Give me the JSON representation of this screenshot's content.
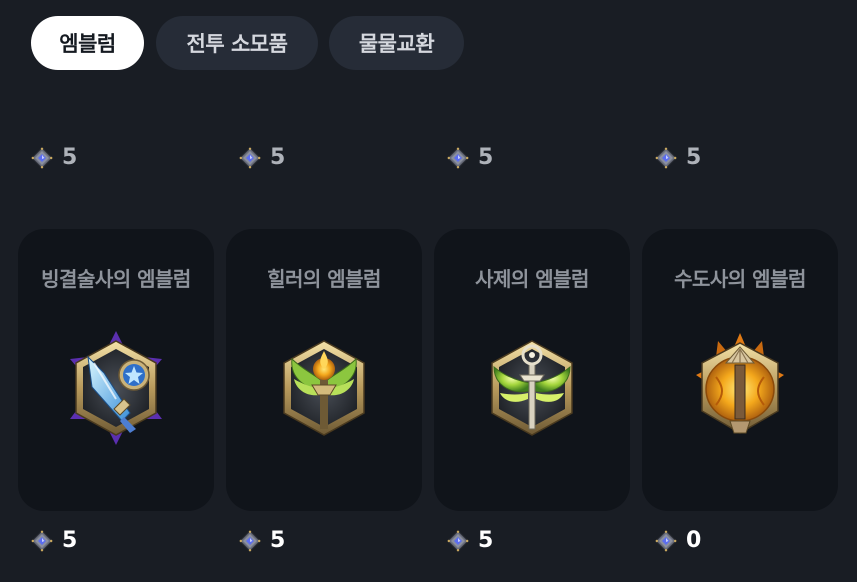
{
  "tabs": [
    {
      "label": "엠블럼",
      "active": true
    },
    {
      "label": "전투 소모품",
      "active": false
    },
    {
      "label": "물물교환",
      "active": false
    }
  ],
  "top_prices": [
    {
      "value": "5"
    },
    {
      "value": "5"
    },
    {
      "value": "5"
    },
    {
      "value": "5"
    }
  ],
  "items": [
    {
      "name": "빙결술사의 엠블럼",
      "price": "5",
      "icon": "frost-mage-emblem-icon"
    },
    {
      "name": "힐러의 엠블럼",
      "price": "5",
      "icon": "healer-emblem-icon"
    },
    {
      "name": "사제의 엠블럼",
      "price": "5",
      "icon": "priest-emblem-icon"
    },
    {
      "name": "수도사의 엠블럼",
      "price": "0",
      "icon": "monk-emblem-icon"
    }
  ],
  "currency_icon": "gem-currency-icon",
  "colors": {
    "background": "#191d24",
    "card": "#10141a",
    "tab_active": "#ffffff",
    "tab_inactive": "#262c37"
  }
}
